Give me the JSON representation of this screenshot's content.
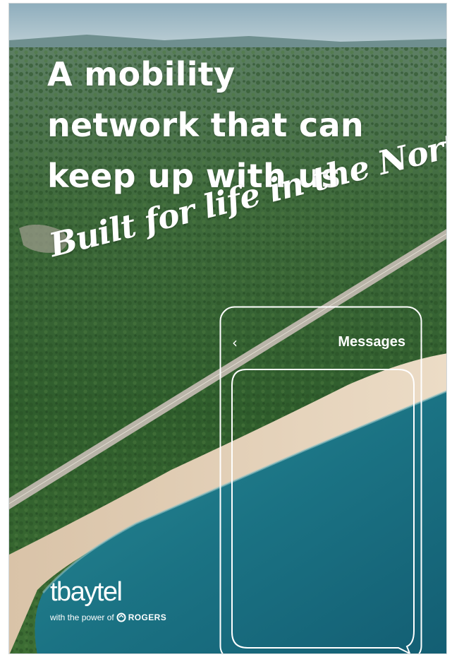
{
  "ad": {
    "headline_lines": [
      "A mobility",
      "network that can",
      "keep up with us"
    ],
    "tagline": "Built for life in the North",
    "phone": {
      "back_icon": "chevron-left-icon",
      "title": "Messages"
    },
    "logo": {
      "brand": "tbaytel",
      "byline_prefix": "with the power of",
      "partner": "ROGERS",
      "partner_icon": "rogers-flag-icon"
    }
  },
  "colors": {
    "sky": "#b7cbd3",
    "forest": "#3c6b34",
    "beach": "#e2cbb0",
    "water": "#1c7e8c",
    "text": "#ffffff"
  }
}
